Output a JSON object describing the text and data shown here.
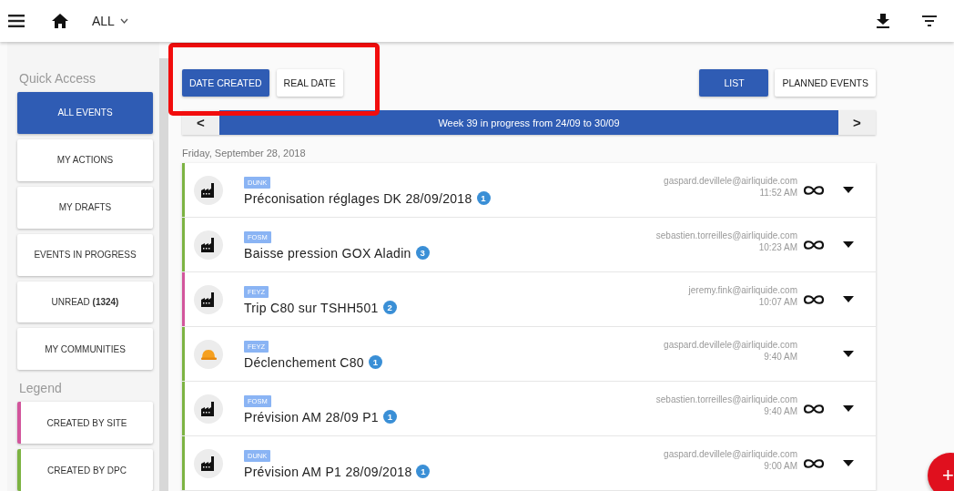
{
  "top_bar": {
    "scope": "ALL"
  },
  "sidebar": {
    "quick_access_title": "Quick Access",
    "items": [
      {
        "label": "ALL EVENTS",
        "selected": true
      },
      {
        "label": "MY ACTIONS",
        "selected": false
      },
      {
        "label": "MY DRAFTS",
        "selected": false
      },
      {
        "label": "EVENTS IN PROGRESS",
        "selected": false
      },
      {
        "label": "UNREAD **(1324)**",
        "selected": false
      },
      {
        "label": "MY COMMUNITIES",
        "selected": false
      }
    ],
    "legend_title": "Legend",
    "legend": [
      {
        "label": "CREATED BY SITE",
        "color": "#d2559c"
      },
      {
        "label": "CREATED BY DPC",
        "color": "#7cb342"
      }
    ]
  },
  "date_toggle": {
    "highlighted": true,
    "options": [
      {
        "label": "DATE CREATED",
        "selected": true
      },
      {
        "label": "REAL DATE",
        "selected": false
      }
    ]
  },
  "view_toggle": [
    {
      "label": "LIST",
      "selected": true
    },
    {
      "label": "PLANNED EVENTS",
      "selected": false
    }
  ],
  "week_bar": {
    "prev": "<",
    "text": "Week 39 in progress from 24/09 to 30/09",
    "next": ">"
  },
  "day_heading": "Friday, September 28, 2018",
  "events": [
    {
      "kind": "factory",
      "color": "#7cb342",
      "tag": "DUNK",
      "title": "Préconisation réglages DK 28/09/2018",
      "count": "1",
      "author": "gaspard.devillele@airliquide.com",
      "time": "11:52 AM",
      "linked": true
    },
    {
      "kind": "factory",
      "color": "#7cb342",
      "tag": "FOSM",
      "title": "Baisse pression GOX Aladin",
      "count": "3",
      "author": "sebastien.torreilles@airliquide.com",
      "time": "10:23 AM",
      "linked": true
    },
    {
      "kind": "factory",
      "color": "#d2559c",
      "tag": "FEYZ",
      "title": "Trip C80 sur TSHH501",
      "count": "2",
      "author": "jeremy.fink@airliquide.com",
      "time": "10:07 AM",
      "linked": true
    },
    {
      "kind": "helmet",
      "color": "#7cb342",
      "tag": "FEYZ",
      "title": "Déclenchement C80",
      "count": "1",
      "author": "gaspard.devillele@airliquide.com",
      "time": "9:40 AM",
      "linked": false
    },
    {
      "kind": "factory",
      "color": "#7cb342",
      "tag": "FOSM",
      "title": "Prévision AM 28/09 P1",
      "count": "1",
      "author": "sebastien.torreilles@airliquide.com",
      "time": "9:40 AM",
      "linked": true
    },
    {
      "kind": "factory",
      "color": "#7cb342",
      "tag": "DUNK",
      "title": "Prévision AM P1 28/09/2018",
      "count": "1",
      "author": "gaspard.devillele@airliquide.com",
      "time": "9:00 AM",
      "linked": true
    }
  ],
  "fab": {
    "label": "+"
  }
}
